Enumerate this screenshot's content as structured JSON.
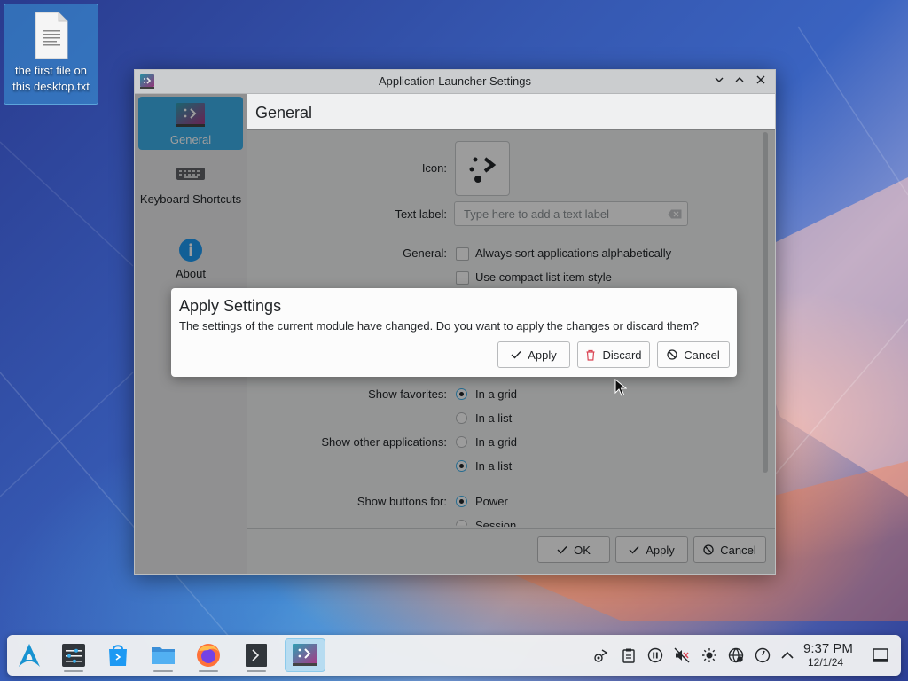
{
  "desktop": {
    "file_label": "the first file on this desktop.txt"
  },
  "window": {
    "title": "Application Launcher Settings",
    "controls": {
      "minimize": "⌄",
      "maximize": "⌃",
      "close": "✕"
    }
  },
  "sidebar": {
    "items": [
      {
        "label": "General",
        "icon": "launcher-icon",
        "active": true
      },
      {
        "label": "Keyboard Shortcuts",
        "icon": "keyboard-icon",
        "active": false
      },
      {
        "label": "About",
        "icon": "info-icon",
        "active": false
      }
    ]
  },
  "general": {
    "heading": "General",
    "icon_label": "Icon:",
    "text_label_label": "Text label:",
    "text_label_placeholder": "Type here to add a text label",
    "general_label": "General:",
    "always_sort": "Always sort applications alphabetically",
    "compact_list": "Use compact list item style",
    "show_favorites_label": "Show favorites:",
    "favorites_grid": "In a grid",
    "favorites_list": "In a list",
    "show_other_label": "Show other applications:",
    "other_grid": "In a grid",
    "other_list": "In a list",
    "show_buttons_label": "Show buttons for:",
    "buttons_power": "Power",
    "buttons_session": "Session"
  },
  "footer": {
    "ok": "OK",
    "apply": "Apply",
    "cancel": "Cancel"
  },
  "dialog": {
    "title": "Apply Settings",
    "message": "The settings of the current module have changed. Do you want to apply the changes or discard them?",
    "apply": "Apply",
    "discard": "Discard",
    "cancel": "Cancel"
  },
  "taskbar": {
    "time": "9:37 PM",
    "date": "12/1/24"
  },
  "colors": {
    "accent": "#3daee9",
    "window_bg": "#eff0f1",
    "text": "#232629"
  }
}
